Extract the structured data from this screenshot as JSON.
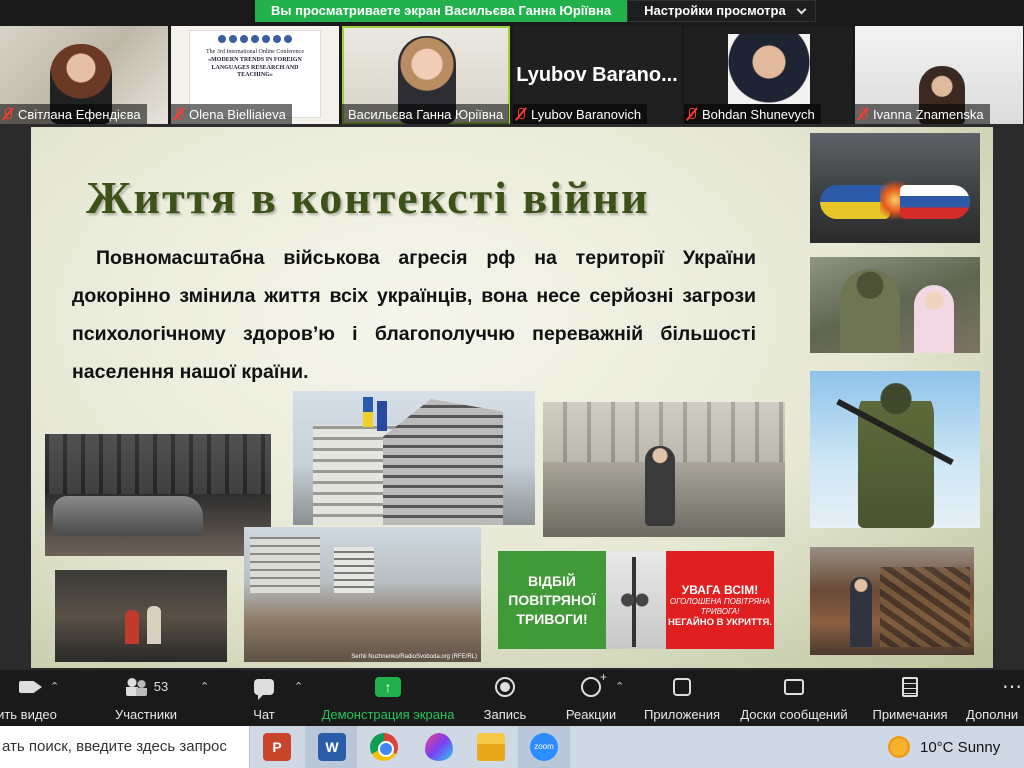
{
  "banner": {
    "viewing_text": "Вы просматриваете экран Васильєва Ганна Юріївна",
    "view_settings": "Настройки просмотра"
  },
  "participants": [
    {
      "name": "Світлана Ефендієва",
      "muted": true,
      "video": true
    },
    {
      "name": "Olena Bielliaieva",
      "muted": true,
      "video": true
    },
    {
      "name": "Васильєва Ганна Юріївна",
      "muted": false,
      "video": true,
      "active": true
    },
    {
      "name": "Lyubov Baranovich",
      "display_name": "Lyubov  Barano...",
      "muted": true,
      "video": false
    },
    {
      "name": "Bohdan Shunevych",
      "muted": true,
      "video": true
    },
    {
      "name": "Ivanna Znamenska",
      "muted": true,
      "video": true
    }
  ],
  "poster": {
    "line1": "The 3rd International Online Conference",
    "line2": "«MODERN TRENDS IN FOREIGN LANGUAGES RESEARCH AND TEACHING»"
  },
  "slide": {
    "title": "Життя в контексті війни",
    "body": "Повномасштабна військова агресія рф на території України докорінно змінила життя всіх українців, вона несе серйозні загрози психологічному здоров’ю і благополуччю переважній більшості населення нашої країни.",
    "alert_left": "ВІДБІЙ ПОВІТРЯНОЇ ТРИВОГИ!",
    "alert_right_1": "УВАГА ВСІМ!",
    "alert_right_2": "ОГОЛОШЕНА ПОВІТРЯНА ТРИВОГА!",
    "alert_right_3": "НЕГАЙНО В УКРИТТЯ.",
    "photo_caption": "Serhii Nuzhnenko/RadioSvoboda.org (RFE/RL)"
  },
  "toolbar": {
    "video": "ить видео",
    "participants": "Участники",
    "participants_count": "53",
    "chat": "Чат",
    "share": "Демонстрация экрана",
    "record": "Запись",
    "reactions": "Реакции",
    "apps": "Приложения",
    "whiteboards": "Доски сообщений",
    "notes": "Примечания",
    "more": "Дополни"
  },
  "taskbar": {
    "search_placeholder": "ать поиск, введите здесь запрос",
    "ppt_label": "P",
    "word_label": "W",
    "zoom_label": "zoom",
    "weather": "10°C  Sunny"
  },
  "colors": {
    "share_green": "#22b14c",
    "title_green": "#3d5218",
    "alert_green": "#3f9a37",
    "alert_red": "#e02020",
    "active_outline": "#9bd23f"
  }
}
